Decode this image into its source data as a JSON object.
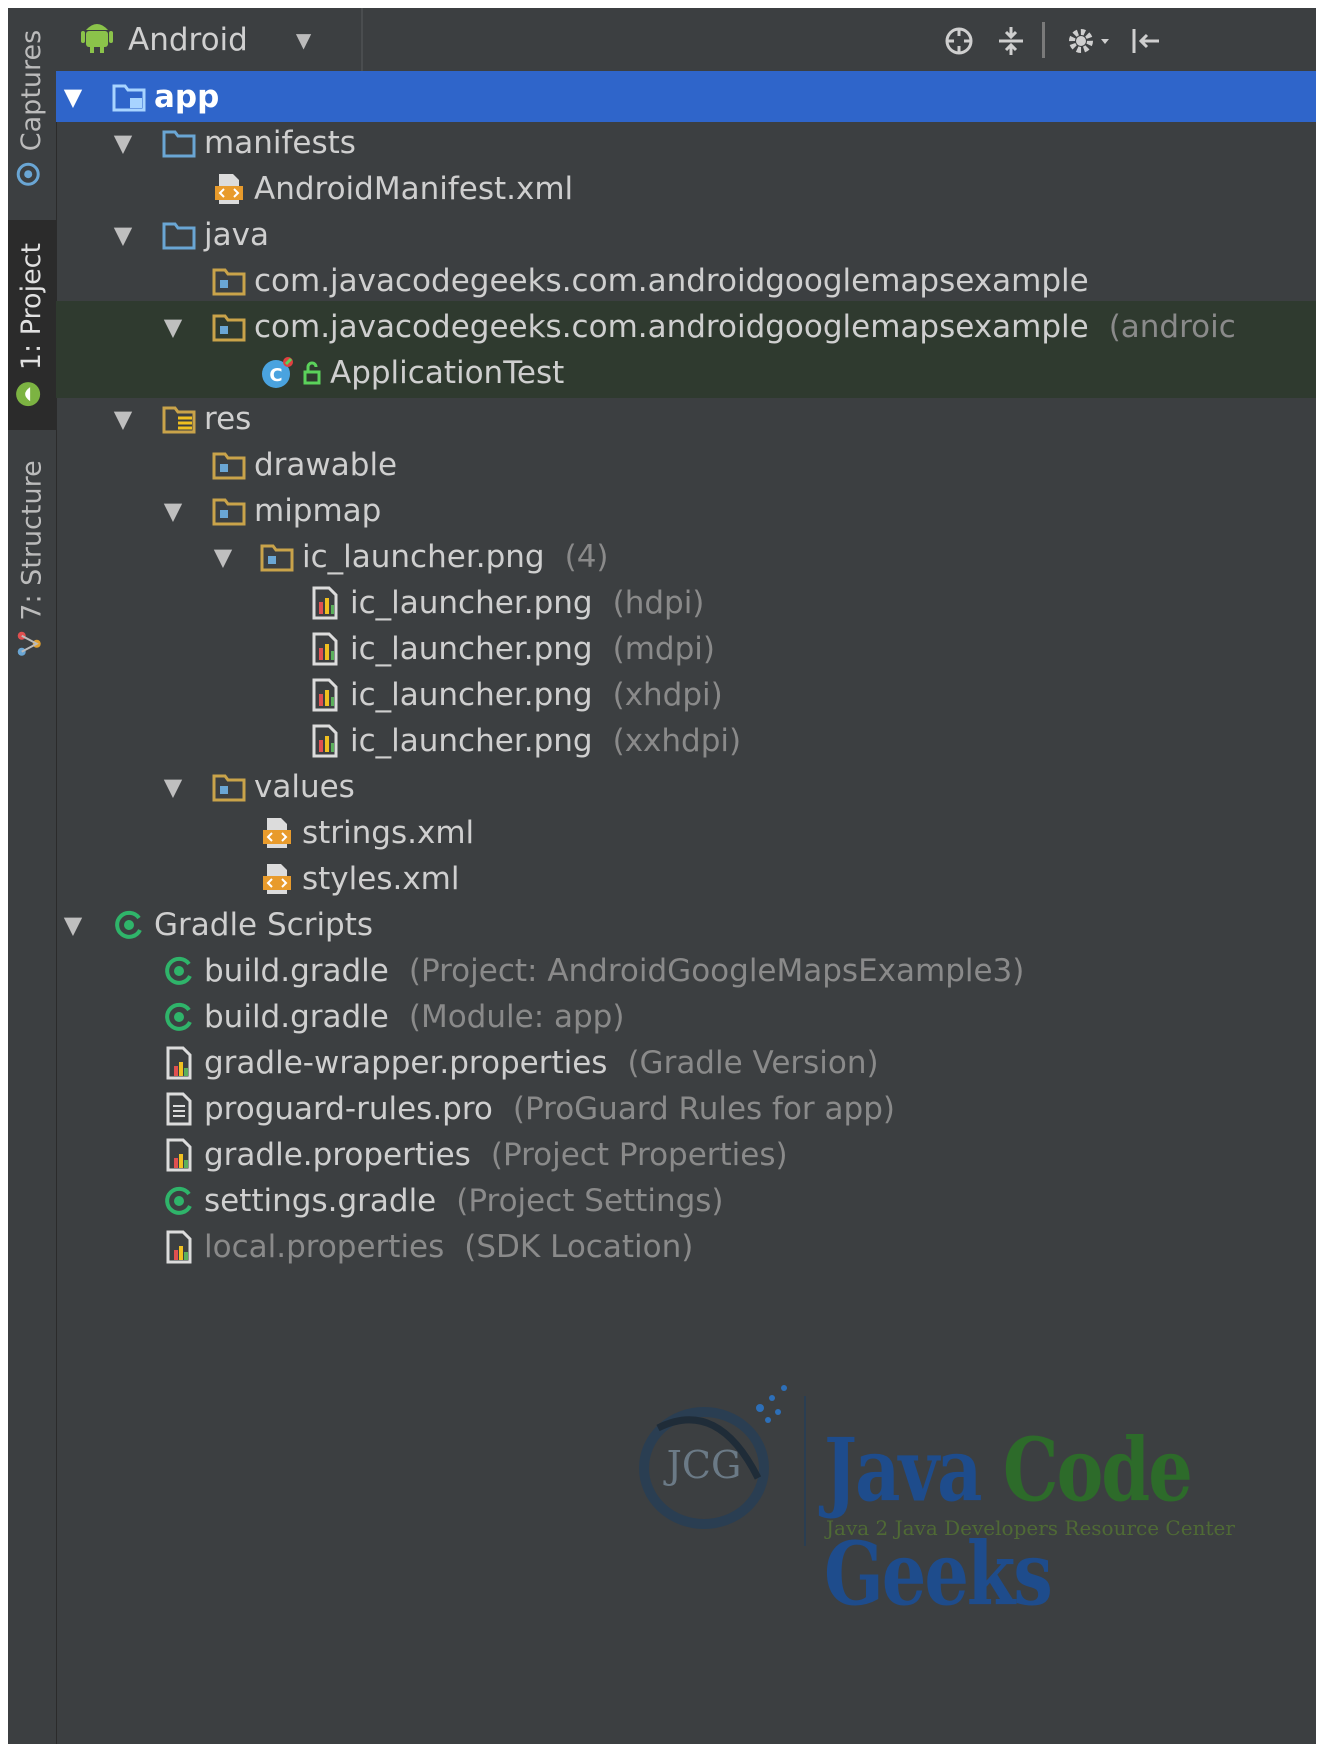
{
  "side_tabs": [
    {
      "label": "Captures",
      "icon": "captures-icon"
    },
    {
      "label": "1: Project",
      "icon": "android-icon"
    },
    {
      "label": "7: Structure",
      "icon": "structure-icon"
    }
  ],
  "toolbar": {
    "view_mode": "Android",
    "icons": [
      "target-icon",
      "collapse-all-icon",
      "gear-icon",
      "hide-panel-icon"
    ]
  },
  "tree": {
    "app": "app",
    "manifests": "manifests",
    "android_manifest": "AndroidManifest.xml",
    "java": "java",
    "pkg_main": "com.javacodegeeks.com.androidgooglemapsexample",
    "pkg_test": "com.javacodegeeks.com.androidgooglemapsexample",
    "pkg_test_hint": "(androic",
    "application_test": "ApplicationTest",
    "res": "res",
    "drawable": "drawable",
    "mipmap": "mipmap",
    "ic_launcher_group": "ic_launcher.png",
    "ic_launcher_group_hint": "(4)",
    "launchers": [
      {
        "name": "ic_launcher.png",
        "hint": "(hdpi)"
      },
      {
        "name": "ic_launcher.png",
        "hint": "(mdpi)"
      },
      {
        "name": "ic_launcher.png",
        "hint": "(xhdpi)"
      },
      {
        "name": "ic_launcher.png",
        "hint": "(xxhdpi)"
      }
    ],
    "values": "values",
    "strings_xml": "strings.xml",
    "styles_xml": "styles.xml",
    "gradle_scripts": "Gradle Scripts",
    "gradle_files": [
      {
        "name": "build.gradle",
        "hint": "(Project: AndroidGoogleMapsExample3)",
        "icon": "gradle-icon"
      },
      {
        "name": "build.gradle",
        "hint": "(Module: app)",
        "icon": "gradle-icon"
      },
      {
        "name": "gradle-wrapper.properties",
        "hint": "(Gradle Version)",
        "icon": "properties-icon"
      },
      {
        "name": "proguard-rules.pro",
        "hint": "(ProGuard Rules for app)",
        "icon": "text-file-icon"
      },
      {
        "name": "gradle.properties",
        "hint": "(Project Properties)",
        "icon": "properties-icon"
      },
      {
        "name": "settings.gradle",
        "hint": "(Project Settings)",
        "icon": "gradle-icon"
      },
      {
        "name": "local.properties",
        "hint": "(SDK Location)",
        "icon": "properties-icon"
      }
    ]
  },
  "watermark": {
    "logo_text": "JCG",
    "title_a": "Java ",
    "title_b": "Code",
    "title_c": " Geeks",
    "subtitle": "Java 2 Java Developers Resource Center"
  },
  "colors": {
    "panel_bg": "#3c3f41",
    "selection": "#2f65ca",
    "folder_blue": "#6aa6d4",
    "folder_yellow": "#c9a34a",
    "gradle_green": "#2fb46a"
  }
}
